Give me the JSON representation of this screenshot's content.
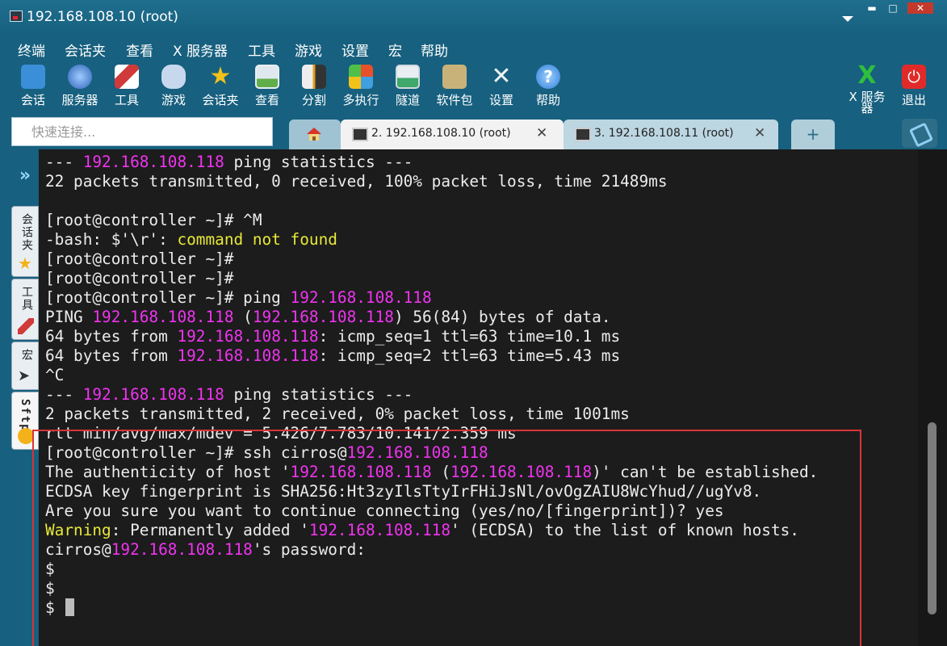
{
  "window": {
    "title": "192.168.108.10 (root)",
    "minimize_label": "▬",
    "maximize_label": "□",
    "close_label": "✕"
  },
  "menu": [
    "终端",
    "会话夹",
    "查看",
    "X 服务器",
    "工具",
    "游戏",
    "设置",
    "宏",
    "帮助"
  ],
  "toolbar": [
    {
      "label": "会话",
      "icon": "sessions-icon",
      "color": "#3a8fd8"
    },
    {
      "label": "服务器",
      "icon": "servers-icon",
      "color": "#4a7fd0"
    },
    {
      "label": "工具",
      "icon": "tools-icon",
      "color": "#d03a3a"
    },
    {
      "label": "游戏",
      "icon": "games-icon",
      "color": "#6a9ad8"
    },
    {
      "label": "会话夹",
      "icon": "star-icon",
      "color": "#f2c21a"
    },
    {
      "label": "查看",
      "icon": "view-icon",
      "color": "#5fae4a"
    },
    {
      "label": "分割",
      "icon": "split-icon",
      "color": "#e0a020"
    },
    {
      "label": "多执行",
      "icon": "multiexec-icon",
      "color": "#e8502a"
    },
    {
      "label": "隧道",
      "icon": "tunnel-icon",
      "color": "#3fa86a"
    },
    {
      "label": "软件包",
      "icon": "packages-icon",
      "color": "#c9b27a"
    },
    {
      "label": "设置",
      "icon": "settings-icon",
      "color": "#c8cdd2"
    },
    {
      "label": "帮助",
      "icon": "help-icon",
      "color": "#3b8ee0"
    }
  ],
  "toolbar_right": [
    {
      "label": "X 服务器",
      "icon": "xserver-icon",
      "color": "#2fbf3c"
    },
    {
      "label": "退出",
      "icon": "exit-icon",
      "color": "#e02a2a"
    }
  ],
  "quick_connect": {
    "placeholder": "快速连接..."
  },
  "tabs": [
    {
      "label": "2. 192.168.108.10 (root)",
      "close": "✕",
      "active": true
    },
    {
      "label": "3. 192.168.108.11 (root)",
      "close": "✕",
      "active": false
    }
  ],
  "new_tab_label": "+",
  "side_panel": {
    "expand": "»",
    "tabs": [
      "会话夹",
      "工具",
      "宏",
      "Sftp"
    ]
  },
  "terminal": {
    "lines": [
      [
        {
          "t": "--- "
        },
        {
          "t": "192.168.108.118",
          "c": "ip"
        },
        {
          "t": " ping statistics ---"
        }
      ],
      [
        {
          "t": "22 packets transmitted, 0 received, 100% packet loss, time 21489ms"
        }
      ],
      [
        {
          "t": ""
        }
      ],
      [
        {
          "t": "[root@controller ~]# ^M"
        }
      ],
      [
        {
          "t": "-bash: $'\\r': "
        },
        {
          "t": "command not found",
          "c": "warn"
        }
      ],
      [
        {
          "t": "[root@controller ~]#"
        }
      ],
      [
        {
          "t": "[root@controller ~]#"
        }
      ],
      [
        {
          "t": "[root@controller ~]# ping "
        },
        {
          "t": "192.168.108.118",
          "c": "ip"
        }
      ],
      [
        {
          "t": "PING "
        },
        {
          "t": "192.168.108.118",
          "c": "ip"
        },
        {
          "t": " ("
        },
        {
          "t": "192.168.108.118",
          "c": "ip"
        },
        {
          "t": ") 56(84) bytes of data."
        }
      ],
      [
        {
          "t": "64 bytes from "
        },
        {
          "t": "192.168.108.118",
          "c": "ip"
        },
        {
          "t": ": icmp_seq=1 ttl=63 time=10.1 ms"
        }
      ],
      [
        {
          "t": "64 bytes from "
        },
        {
          "t": "192.168.108.118",
          "c": "ip"
        },
        {
          "t": ": icmp_seq=2 ttl=63 time=5.43 ms"
        }
      ],
      [
        {
          "t": "^C"
        }
      ],
      [
        {
          "t": "--- "
        },
        {
          "t": "192.168.108.118",
          "c": "ip"
        },
        {
          "t": " ping statistics ---"
        }
      ],
      [
        {
          "t": "2 packets transmitted, 2 received, 0% packet loss, time 1001ms"
        }
      ],
      [
        {
          "t": "rtt min/avg/max/mdev = 5.426/7.783/10.141/2.359 ms"
        }
      ],
      [
        {
          "t": "[root@controller ~]# ssh cirros@"
        },
        {
          "t": "192.168.108.118",
          "c": "ip"
        }
      ],
      [
        {
          "t": "The authenticity of host '"
        },
        {
          "t": "192.168.108.118",
          "c": "ip"
        },
        {
          "t": " ("
        },
        {
          "t": "192.168.108.118",
          "c": "ip"
        },
        {
          "t": ")' can't be established."
        }
      ],
      [
        {
          "t": "ECDSA key fingerprint is SHA256:Ht3zyIlsTtyIrFHiJsNl/ovOgZAIU8WcYhud//ugYv8."
        }
      ],
      [
        {
          "t": "Are you sure you want to continue connecting (yes/no/[fingerprint])? yes"
        }
      ],
      [
        {
          "t": "Warning",
          "c": "warn"
        },
        {
          "t": ": Permanently added '"
        },
        {
          "t": "192.168.108.118",
          "c": "ip"
        },
        {
          "t": "' (ECDSA) to the list of known hosts."
        }
      ],
      [
        {
          "t": "cirros@"
        },
        {
          "t": "192.168.108.118",
          "c": "ip"
        },
        {
          "t": "'s password:"
        }
      ],
      [
        {
          "t": "$"
        }
      ],
      [
        {
          "t": "$"
        }
      ],
      [
        {
          "t": "$ "
        },
        {
          "cursor": true
        }
      ]
    ]
  }
}
